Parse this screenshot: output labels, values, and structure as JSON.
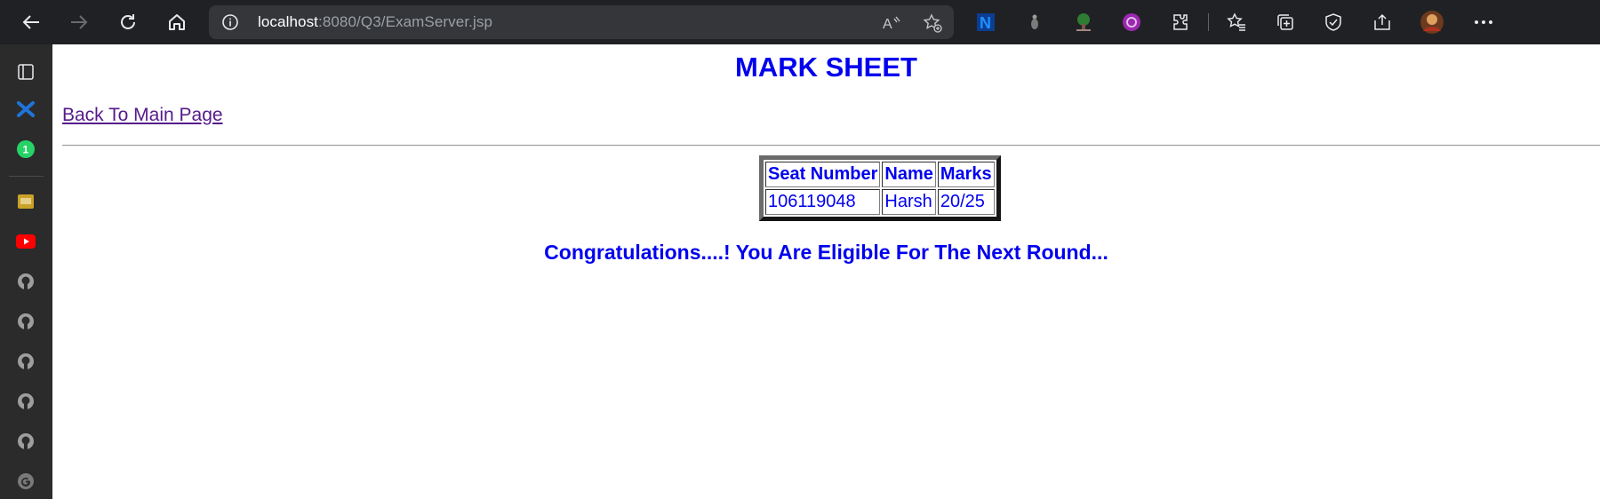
{
  "browser": {
    "url_host": "localhost",
    "url_path": ":8080/Q3/ExamServer.jsp"
  },
  "icons": {
    "nav": [
      "back-arrow-icon",
      "forward-arrow-icon",
      "refresh-icon",
      "home-icon"
    ],
    "url_actions": [
      "read-aloud-icon",
      "add-favorite-icon"
    ],
    "toolbar": [
      "notion-extension-icon",
      "grey-extension-icon",
      "tree-extension-icon",
      "purple-extension-icon",
      "extensions-puzzle-icon",
      "favorites-icon",
      "collections-icon",
      "browser-essentials-icon",
      "share-icon",
      "profile-avatar",
      "more-menu-icon"
    ],
    "sidebar": [
      "tab-actions-icon",
      "blue-x-extension-icon",
      "whatsapp-icon",
      "yellow-app-icon",
      "youtube-icon",
      "github-icon",
      "github-icon",
      "github-icon",
      "github-icon",
      "github-icon",
      "google-icon"
    ]
  },
  "sidebar": {
    "whatsapp_badge": "1"
  },
  "page": {
    "title": "MARK SHEET",
    "back_link": "Back To Main Page",
    "table": {
      "headers": [
        "Seat Number",
        "Name",
        "Marks"
      ],
      "rows": [
        [
          "106119048",
          "Harsh",
          "20/25"
        ]
      ]
    },
    "result_message": "Congratulations....! You Are Eligible For The Next Round..."
  },
  "colors": {
    "page_text": "#0000ee",
    "visited_link": "#551a8b",
    "browser_chrome": "#202124",
    "sidebar": "#2b2b2b"
  }
}
